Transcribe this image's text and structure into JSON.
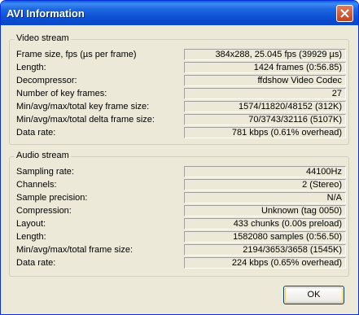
{
  "window": {
    "title": "AVI Information"
  },
  "video": {
    "heading": "Video stream",
    "rows": [
      {
        "label": "Frame size, fps (µs per frame)",
        "value": "384x288, 25.045 fps (39929 µs)"
      },
      {
        "label": "Length:",
        "value": "1424 frames (0:56.85)"
      },
      {
        "label": "Decompressor:",
        "value": "ffdshow Video Codec"
      },
      {
        "label": "Number of key frames:",
        "value": "27"
      },
      {
        "label": "Min/avg/max/total key frame size:",
        "value": "1574/11820/48152 (312K)"
      },
      {
        "label": "Min/avg/max/total delta frame size:",
        "value": "70/3743/32116 (5107K)"
      },
      {
        "label": "Data rate:",
        "value": "781 kbps (0.61% overhead)"
      }
    ]
  },
  "audio": {
    "heading": "Audio stream",
    "rows": [
      {
        "label": "Sampling rate:",
        "value": "44100Hz"
      },
      {
        "label": "Channels:",
        "value": "2 (Stereo)"
      },
      {
        "label": "Sample precision:",
        "value": "N/A"
      },
      {
        "label": "Compression:",
        "value": "Unknown (tag 0050)"
      },
      {
        "label": "Layout:",
        "value": "433 chunks (0.00s preload)"
      },
      {
        "label": "Length:",
        "value": "1582080 samples (0:56.50)"
      },
      {
        "label": "Min/avg/max/total frame size:",
        "value": "2194/3653/3658 (1545K)"
      },
      {
        "label": "Data rate:",
        "value": "224 kbps (0.65% overhead)"
      }
    ]
  },
  "buttons": {
    "ok": "OK"
  }
}
